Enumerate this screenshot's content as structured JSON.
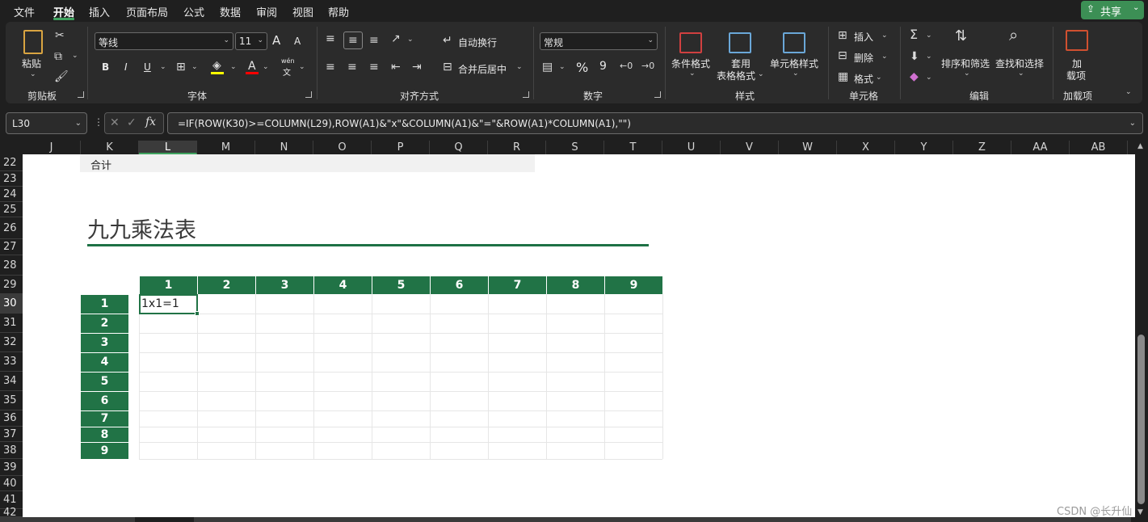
{
  "menu": {
    "items": [
      "文件",
      "开始",
      "插入",
      "页面布局",
      "公式",
      "数据",
      "审阅",
      "视图",
      "帮助"
    ],
    "share_label": "共享"
  },
  "ribbon": {
    "clipboard": {
      "paste": "粘贴",
      "label": "剪贴板"
    },
    "font": {
      "name": "等线",
      "size": "11",
      "bold": "B",
      "italic": "I",
      "underline": "U",
      "label": "字体",
      "grow": "A",
      "shrink": "A",
      "color_a": "A",
      "wen": "wén",
      "wen2": "文"
    },
    "align": {
      "wrap": "自动换行",
      "merge": "合并后居中",
      "label": "对齐方式"
    },
    "number": {
      "format": "常规",
      "percent": "%",
      "comma": "9",
      "label": "数字"
    },
    "styles": {
      "cond": "条件格式",
      "table1": "套用",
      "table2": "表格格式",
      "cell": "单元格样式",
      "label": "样式"
    },
    "cells": {
      "insert": "插入",
      "delete": "删除",
      "format": "格式",
      "label": "单元格"
    },
    "edit": {
      "sort": "排序和筛选",
      "find": "查找和选择",
      "label": "编辑"
    },
    "addins": {
      "l1": "加",
      "l2": "载项",
      "label": "加载项"
    }
  },
  "formula_bar": {
    "name_box": "L30",
    "formula": "=IF(ROW(K30)>=COLUMN(L29),ROW(A1)&\"x\"&COLUMN(A1)&\"=\"&ROW(A1)*COLUMN(A1),\"\")"
  },
  "columns": [
    "J",
    "K",
    "L",
    "M",
    "N",
    "O",
    "P",
    "Q",
    "R",
    "S",
    "T",
    "U",
    "V",
    "W",
    "X",
    "Y",
    "Z",
    "AA",
    "AB"
  ],
  "rows": [
    "22",
    "23",
    "24",
    "25",
    "26",
    "27",
    "28",
    "29",
    "30",
    "31",
    "32",
    "33",
    "34",
    "35",
    "36",
    "37",
    "38",
    "39",
    "40",
    "41",
    "42"
  ],
  "selected": {
    "column": "L",
    "row": "30"
  },
  "sheet": {
    "total_label": "合计",
    "title": "九九乘法表",
    "header_cols": [
      "1",
      "2",
      "3",
      "4",
      "5",
      "6",
      "7",
      "8",
      "9"
    ],
    "header_rows": [
      "1",
      "2",
      "3",
      "4",
      "5",
      "6",
      "7",
      "8",
      "9"
    ],
    "active_value": "1x1=1"
  },
  "watermark": "CSDN @长升仙",
  "colors": {
    "accent": "#217346",
    "ribbon_bg": "#2b2b2b",
    "share": "#3c8f55"
  }
}
